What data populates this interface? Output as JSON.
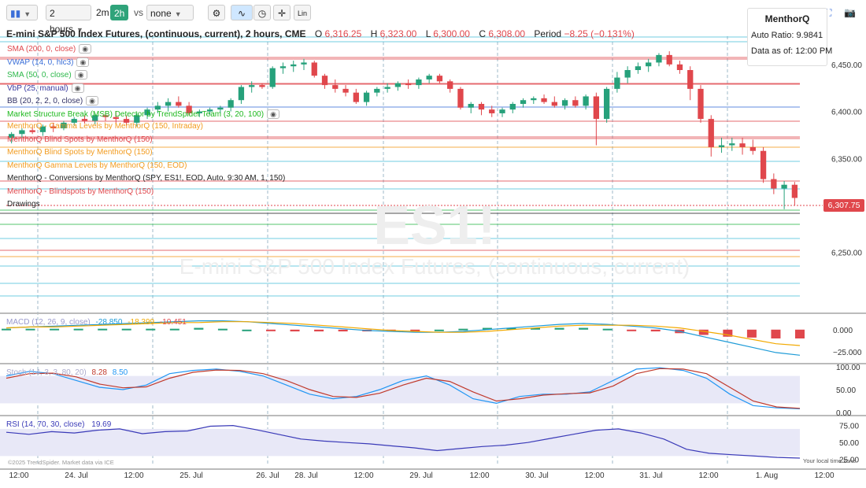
{
  "toolbar": {
    "interval": "2 hours",
    "quick_2m": "2m",
    "quick_2h": "2h",
    "vs_label": "vs",
    "compare": "none",
    "lin_label": "Lin",
    "icons": [
      "candles-icon",
      "settings-icon",
      "indicators-icon",
      "clock-icon",
      "crosshair-icon",
      "lin-scale-icon",
      "expand-icon",
      "camera-icon"
    ]
  },
  "header": {
    "title": "E-mini S&P 500 Index Futures, (continuous, current), 2 hours, CME",
    "open_label": "O",
    "open": "6,316.25",
    "high_label": "H",
    "high": "6,323.00",
    "low_label": "L",
    "low": "6,300.00",
    "close_label": "C",
    "close": "6,308.00",
    "period_label": "Period",
    "period": "−8.25 (−0.131%)"
  },
  "indicators": [
    {
      "label": "SMA (200, 0, close)",
      "color": "#e0474c",
      "eye": true
    },
    {
      "label": "VWAP (14, 0, hlc3)",
      "color": "#3b6fd8",
      "eye": true
    },
    {
      "label": "SMA (50, 0, close)",
      "color": "#2db84b",
      "eye": true
    },
    {
      "label": "VbP (25, manual)",
      "color": "#3a3aa0",
      "eye": true
    },
    {
      "label": "BB (20, 2, 2, 0, close)",
      "color": "#333366",
      "eye": true
    },
    {
      "label": "Market Structure Break (MSB) Detector by TrendSpider Team (3, 20, 100)",
      "color": "#1db81d",
      "eye": true
    },
    {
      "label": "MenthorQ - Gamma Levels by MenthorQ (150, Intraday)",
      "color": "#f29b1e",
      "eye": false
    },
    {
      "label": "MenthorQ Blind Spots by MenthorQ (150)",
      "color": "#e0474c",
      "eye": false
    },
    {
      "label": "MenthorQ Blind Spots by MenthorQ (150)",
      "color": "#f29b1e",
      "eye": false
    },
    {
      "label": "MenthorQ Gamma Levels by MenthorQ (150, EOD)",
      "color": "#f29b1e",
      "eye": false
    },
    {
      "label": "MenthorQ - Conversions by MenthorQ (SPY, ES1!, EOD, Auto, 9:30 AM, 1, 150)",
      "color": "#222222",
      "eye": false
    },
    {
      "label": "MenthorQ - Blindspots by MenthorQ (150)",
      "color": "#e0474c",
      "eye": false
    },
    {
      "label": "Drawings",
      "color": "#222222",
      "eye": false
    }
  ],
  "infobox": {
    "title": "MenthorQ",
    "auto_ratio": "Auto Ratio: 9.9841",
    "data_as_of": "Data as of: 12:00 PM"
  },
  "watermark": {
    "symbol": "ES1!",
    "name": "E-mini S&P 500 Index Futures, (continuous, current)"
  },
  "footer": {
    "copyright": "©2025 TrendSpider. Market data via ICE",
    "tz": "Your local time zone"
  },
  "colors": {
    "up": "#26a17b",
    "down": "#e0474c",
    "macd_line": "#1e9bd7",
    "signal_line": "#f2a900",
    "stoch_k": "#2196f3",
    "stoch_d": "#c0392b",
    "rsi_line": "#3a3ab8"
  },
  "chart_data": [
    {
      "type": "candlestick",
      "title": "E-mini S&P 500 Index Futures, (continuous, current), 2 hours, CME",
      "x_tick_labels": [
        "12:00",
        "24. Jul",
        "12:00",
        "25. Jul",
        "26. Jul",
        "28. Jul",
        "12:00",
        "29. Jul",
        "12:00",
        "30. Jul",
        "12:00",
        "31. Jul",
        "12:00",
        "1. Aug",
        "12:00"
      ],
      "y_tick_labels": [
        "6,450.00",
        "6,400.00",
        "6,350.00",
        "6,300.00",
        "6,250.00"
      ],
      "ylim": [
        6192,
        6480
      ],
      "last_price": "6,307.75",
      "candles": [
        [
          6372,
          6378,
          6366,
          6376
        ],
        [
          6376,
          6382,
          6372,
          6380
        ],
        [
          6380,
          6384,
          6376,
          6378
        ],
        [
          6378,
          6386,
          6374,
          6384
        ],
        [
          6384,
          6388,
          6378,
          6382
        ],
        [
          6382,
          6390,
          6380,
          6388
        ],
        [
          6388,
          6394,
          6385,
          6392
        ],
        [
          6392,
          6396,
          6387,
          6390
        ],
        [
          6390,
          6398,
          6386,
          6396
        ],
        [
          6396,
          6400,
          6390,
          6394
        ],
        [
          6394,
          6400,
          6388,
          6392
        ],
        [
          6392,
          6396,
          6385,
          6388
        ],
        [
          6388,
          6398,
          6384,
          6396
        ],
        [
          6396,
          6404,
          6392,
          6402
        ],
        [
          6402,
          6410,
          6398,
          6406
        ],
        [
          6406,
          6414,
          6400,
          6410
        ],
        [
          6410,
          6416,
          6404,
          6406
        ],
        [
          6406,
          6410,
          6396,
          6398
        ],
        [
          6398,
          6402,
          6394,
          6400
        ],
        [
          6400,
          6404,
          6396,
          6402
        ],
        [
          6402,
          6406,
          6398,
          6404
        ],
        [
          6404,
          6414,
          6400,
          6412
        ],
        [
          6412,
          6428,
          6408,
          6426
        ],
        [
          6426,
          6432,
          6420,
          6428
        ],
        [
          6428,
          6430,
          6424,
          6426
        ],
        [
          6426,
          6448,
          6424,
          6446
        ],
        [
          6446,
          6452,
          6440,
          6448
        ],
        [
          6448,
          6454,
          6442,
          6450
        ],
        [
          6450,
          6456,
          6444,
          6452
        ],
        [
          6452,
          6454,
          6436,
          6438
        ],
        [
          6438,
          6440,
          6424,
          6428
        ],
        [
          6428,
          6434,
          6420,
          6424
        ],
        [
          6424,
          6428,
          6416,
          6420
        ],
        [
          6420,
          6424,
          6408,
          6410
        ],
        [
          6410,
          6422,
          6406,
          6420
        ],
        [
          6420,
          6426,
          6416,
          6424
        ],
        [
          6424,
          6430,
          6420,
          6426
        ],
        [
          6426,
          6432,
          6422,
          6430
        ],
        [
          6430,
          6434,
          6424,
          6428
        ],
        [
          6428,
          6436,
          6424,
          6434
        ],
        [
          6434,
          6440,
          6430,
          6438
        ],
        [
          6438,
          6440,
          6430,
          6432
        ],
        [
          6432,
          6434,
          6420,
          6424
        ],
        [
          6424,
          6426,
          6402,
          6404
        ],
        [
          6404,
          6410,
          6398,
          6408
        ],
        [
          6408,
          6410,
          6396,
          6402
        ],
        [
          6402,
          6406,
          6394,
          6398
        ],
        [
          6398,
          6404,
          6394,
          6402
        ],
        [
          6402,
          6410,
          6398,
          6408
        ],
        [
          6408,
          6414,
          6404,
          6412
        ],
        [
          6412,
          6416,
          6408,
          6414
        ],
        [
          6414,
          6418,
          6408,
          6410
        ],
        [
          6410,
          6416,
          6404,
          6406
        ],
        [
          6406,
          6414,
          6402,
          6412
        ],
        [
          6412,
          6416,
          6404,
          6406
        ],
        [
          6406,
          6418,
          6402,
          6416
        ],
        [
          6416,
          6420,
          6364,
          6392
        ],
        [
          6392,
          6426,
          6388,
          6424
        ],
        [
          6424,
          6442,
          6420,
          6436
        ],
        [
          6436,
          6448,
          6430,
          6444
        ],
        [
          6444,
          6452,
          6440,
          6448
        ],
        [
          6448,
          6456,
          6442,
          6452
        ],
        [
          6452,
          6462,
          6448,
          6460
        ],
        [
          6460,
          6464,
          6448,
          6450
        ],
        [
          6450,
          6454,
          6440,
          6444
        ],
        [
          6444,
          6448,
          6412,
          6424
        ],
        [
          6424,
          6428,
          6388,
          6392
        ],
        [
          6392,
          6396,
          6352,
          6362
        ],
        [
          6362,
          6372,
          6356,
          6364
        ],
        [
          6364,
          6372,
          6358,
          6366
        ],
        [
          6366,
          6372,
          6354,
          6362
        ],
        [
          6362,
          6370,
          6354,
          6358
        ],
        [
          6358,
          6362,
          6324,
          6328
        ],
        [
          6328,
          6334,
          6312,
          6318
        ],
        [
          6318,
          6326,
          6296,
          6322
        ],
        [
          6322,
          6325,
          6300,
          6308
        ]
      ]
    },
    {
      "type": "line",
      "title": "MACD (12, 26, 9, close)",
      "legend_values": [
        "-28.850",
        "-18.399",
        "-10.451"
      ],
      "y_tick_labels": [
        "0.000",
        "−25.000"
      ],
      "ylim": [
        -35,
        15
      ],
      "series": [
        {
          "name": "MACD",
          "values": [
            2,
            3,
            4,
            5,
            6,
            7,
            8,
            9,
            10,
            10,
            9,
            7,
            5,
            3,
            1,
            -1,
            -2,
            -3,
            -3,
            -2,
            0,
            2,
            4,
            6,
            7,
            6,
            4,
            2,
            -2,
            -8,
            -14,
            -20,
            -26,
            -29
          ]
        },
        {
          "name": "Signal",
          "values": [
            2,
            3,
            3,
            4,
            5,
            6,
            7,
            8,
            8,
            9,
            9,
            8,
            7,
            5,
            3,
            1,
            -1,
            -2,
            -3,
            -3,
            -2,
            0,
            2,
            4,
            5,
            5,
            5,
            4,
            2,
            -2,
            -6,
            -11,
            -16,
            -18
          ]
        }
      ],
      "histogram": [
        1,
        1,
        1,
        1,
        1,
        1,
        1,
        1,
        2,
        1,
        0,
        -1,
        -2,
        -2,
        -2,
        -2,
        -1,
        -1,
        0,
        1,
        2,
        2,
        2,
        2,
        2,
        1,
        -1,
        -2,
        -4,
        -6,
        -8,
        -9,
        -10,
        -10
      ]
    },
    {
      "type": "line",
      "title": "Stoch (14, 3, 3, 80, 20)",
      "legend_values": [
        "8.28",
        "8.50"
      ],
      "y_tick_labels": [
        "100.00",
        "50.00",
        "0.00"
      ],
      "ylim": [
        0,
        100
      ],
      "series": [
        {
          "name": "%K",
          "values": [
            80,
            90,
            85,
            70,
            55,
            50,
            60,
            85,
            92,
            95,
            90,
            80,
            60,
            40,
            30,
            35,
            50,
            70,
            80,
            60,
            30,
            20,
            35,
            40,
            40,
            45,
            70,
            95,
            98,
            92,
            75,
            40,
            15,
            10,
            8
          ]
        },
        {
          "name": "%D",
          "values": [
            75,
            85,
            86,
            78,
            62,
            54,
            56,
            75,
            88,
            93,
            92,
            85,
            70,
            50,
            35,
            33,
            42,
            60,
            75,
            68,
            45,
            25,
            30,
            38,
            41,
            43,
            58,
            85,
            96,
            95,
            85,
            55,
            25,
            12,
            9
          ]
        }
      ]
    },
    {
      "type": "line",
      "title": "RSI (14, 70, 30, close)",
      "legend_values": [
        "19.69"
      ],
      "y_tick_labels": [
        "75.00",
        "50.00",
        "25.00"
      ],
      "ylim": [
        20,
        85
      ],
      "series": [
        {
          "name": "RSI",
          "values": [
            65,
            62,
            66,
            64,
            68,
            70,
            63,
            66,
            67,
            74,
            75,
            69,
            62,
            55,
            52,
            50,
            48,
            45,
            42,
            38,
            41,
            44,
            46,
            50,
            56,
            62,
            68,
            70,
            64,
            55,
            40,
            34,
            32,
            30,
            28,
            27
          ]
        }
      ]
    }
  ]
}
